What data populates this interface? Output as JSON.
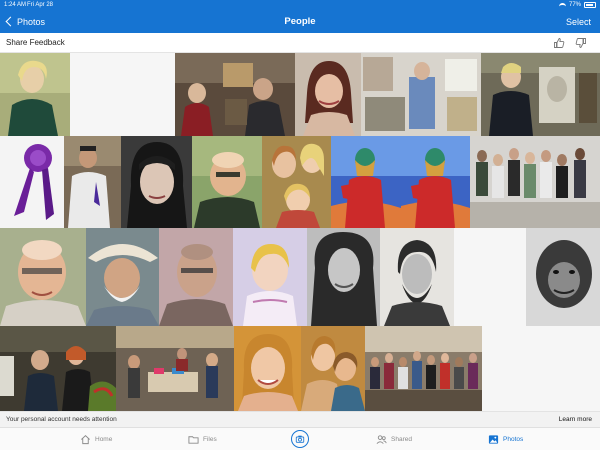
{
  "status_bar": {
    "time": "1:24 AM",
    "date": "Fri Apr 28",
    "battery": "77%"
  },
  "nav": {
    "back_label": "Photos",
    "title": "People",
    "select_label": "Select"
  },
  "feedback": {
    "label": "Share Feedback"
  },
  "banner": {
    "message": "Your personal account needs attention",
    "action": "Learn more"
  },
  "tabs": [
    {
      "label": "Home",
      "icon": "home-icon",
      "active": false
    },
    {
      "label": "Files",
      "icon": "folder-icon",
      "active": false
    },
    {
      "label": "Shared",
      "icon": "people-icon",
      "active": false
    },
    {
      "label": "Photos",
      "icon": "photos-icon",
      "active": true
    }
  ],
  "colors": {
    "accent": "#1674d2",
    "banner_bg": "#f2f2f2",
    "tabbar_bg": "#fafafa"
  }
}
